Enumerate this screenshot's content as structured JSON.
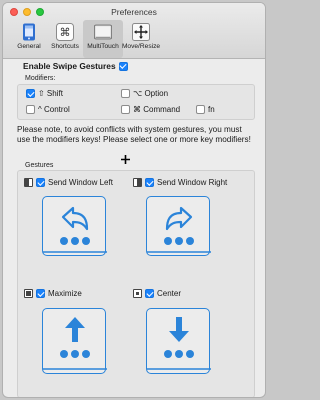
{
  "window": {
    "title": "Preferences"
  },
  "toolbar": {
    "items": [
      {
        "label": "General",
        "icon": "phone-icon"
      },
      {
        "label": "Shortcuts",
        "icon": "command-key-icon"
      },
      {
        "label": "MultiTouch",
        "icon": "trackpad-icon",
        "selected": true
      },
      {
        "label": "Move/Resize",
        "icon": "move-arrows-icon"
      }
    ]
  },
  "swipe": {
    "enable_label": "Enable Swipe Gestures",
    "enabled": true
  },
  "modifiers": {
    "title": "Modifiers:",
    "shift": {
      "label": "⇧ Shift",
      "checked": true
    },
    "option": {
      "label": "⌥ Option",
      "checked": false
    },
    "control": {
      "label": "^ Control",
      "checked": false
    },
    "command": {
      "label": "⌘ Command",
      "checked": false
    },
    "fn": {
      "label": "fn",
      "checked": false
    }
  },
  "note": "Please note, to avoid conflicts with system gestures, you must use the modifiers keys! Please select one or more key modifiers!",
  "gestures": {
    "title": "Gestures",
    "items": [
      {
        "label": "Send Window Left",
        "checked": true,
        "icon": "arrow-back-icon"
      },
      {
        "label": "Send Window Right",
        "checked": true,
        "icon": "arrow-forward-icon"
      },
      {
        "label": "Maximize",
        "checked": true,
        "icon": "arrow-up-icon"
      },
      {
        "label": "Center",
        "checked": true,
        "icon": "arrow-down-icon"
      }
    ]
  },
  "colors": {
    "accent": "#2b84d9",
    "checkbox": "#1a82fb"
  }
}
